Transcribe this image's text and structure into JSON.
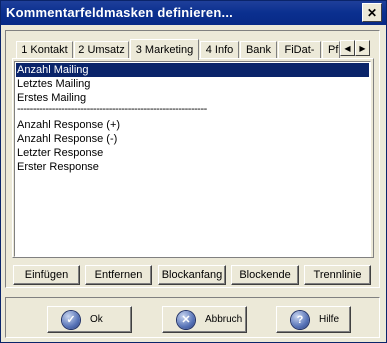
{
  "window": {
    "title": "Kommentarfeldmasken definieren..."
  },
  "tabs": [
    {
      "label": "1 Kontakt"
    },
    {
      "label": "2 Umsatz"
    },
    {
      "label": "3 Marketing"
    },
    {
      "label": "4 Info"
    },
    {
      "label": "Bank"
    },
    {
      "label": "FiDat-"
    },
    {
      "label": "Pf"
    }
  ],
  "active_tab": "3 Marketing",
  "list": {
    "items": [
      {
        "label": "Anzahl Mailing",
        "selected": true
      },
      {
        "label": "Letztes Mailing"
      },
      {
        "label": "Erstes Mailing"
      },
      {
        "label": "------------------------------------------------------------",
        "separator": true
      },
      {
        "label": "Anzahl Response (+)"
      },
      {
        "label": "Anzahl Response (-)"
      },
      {
        "label": "Letzter Response"
      },
      {
        "label": "Erster Response"
      }
    ]
  },
  "actions": {
    "insert": "Einfügen",
    "remove": "Entfernen",
    "block_start": "Blockanfang",
    "block_end": "Blockende",
    "separator_line": "Trennlinie"
  },
  "dialog": {
    "ok": "Ok",
    "cancel": "Abbruch",
    "help": "Hilfe"
  },
  "colors": {
    "title_bar": "#0a2f8f",
    "selection": "#0a246a",
    "face": "#ece9d8"
  },
  "icons": {
    "close": "close-icon",
    "ok": "checkmark-icon",
    "cancel": "x-circle-icon",
    "help": "question-icon"
  }
}
